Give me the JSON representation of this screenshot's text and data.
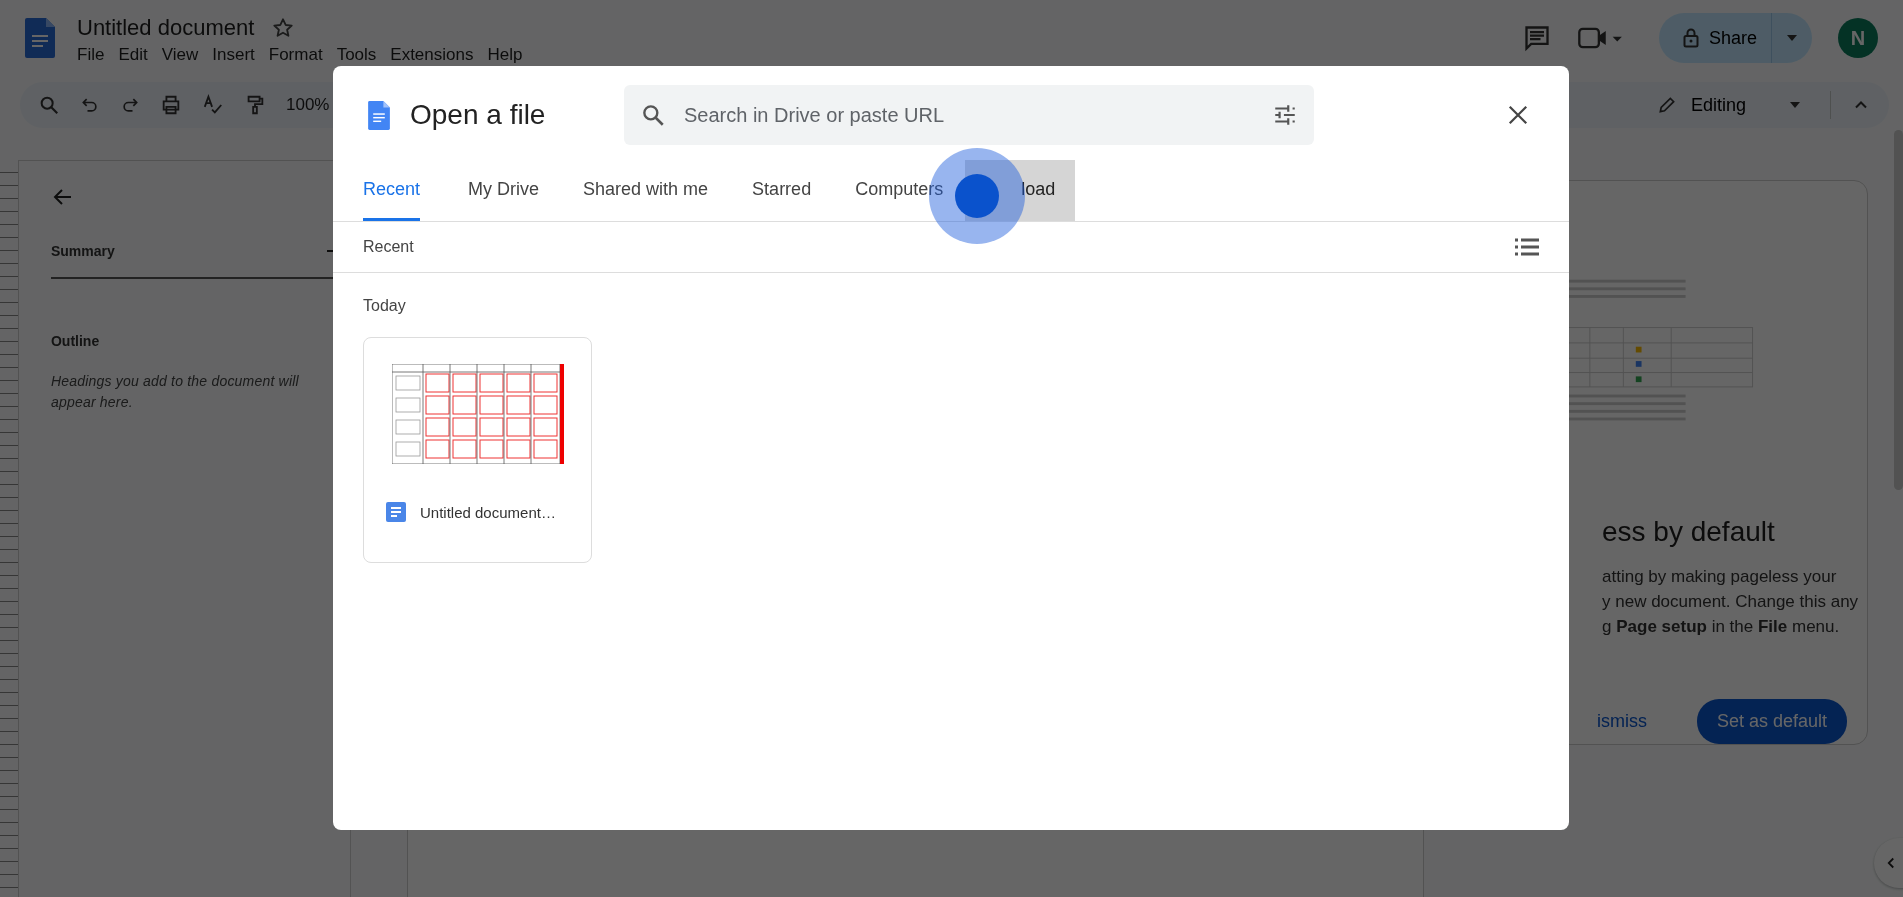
{
  "app": {
    "title": "Untitled document",
    "starred": false,
    "menu": [
      "File",
      "Edit",
      "View",
      "Insert",
      "Format",
      "Tools",
      "Extensions",
      "Help"
    ]
  },
  "toolbar": {
    "zoom": "100%",
    "mode": "Editing"
  },
  "share": {
    "label": "Share"
  },
  "avatar": {
    "initial": "N"
  },
  "outline": {
    "summary_label": "Summary",
    "outline_label": "Outline",
    "hint": "Headings you add to the document will appear here."
  },
  "promo": {
    "title": "ess by default",
    "body": "atting by making pageless your\ny new document. Change this any\ng **Page setup** in the **File** menu.",
    "dismiss": "ismiss",
    "confirm": "Set as default"
  },
  "dialog": {
    "title": "Open a file",
    "search": {
      "placeholder": "Search in Drive or paste URL"
    },
    "tabs": [
      {
        "label": "Recent",
        "selected": true,
        "hovered": false
      },
      {
        "label": "My Drive",
        "selected": false,
        "hovered": false
      },
      {
        "label": "Shared with me",
        "selected": false,
        "hovered": false
      },
      {
        "label": "Starred",
        "selected": false,
        "hovered": false
      },
      {
        "label": "Computers",
        "selected": false,
        "hovered": false
      },
      {
        "label": "load",
        "selected": false,
        "hovered": true
      }
    ],
    "section": "Recent",
    "group": "Today",
    "files": [
      {
        "name": "Untitled document…"
      }
    ]
  }
}
